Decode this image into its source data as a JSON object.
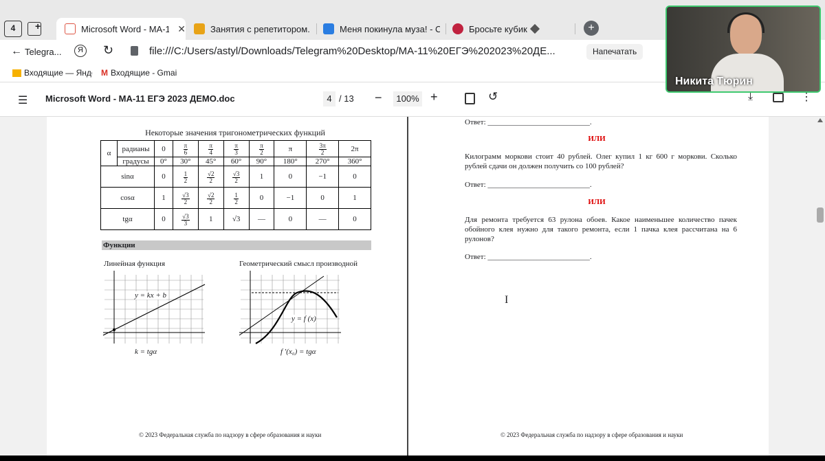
{
  "tabs": {
    "counter": "4",
    "items": [
      {
        "label": "Microsoft Word - МА-1"
      },
      {
        "label": "Занятия с репетитором. М"
      },
      {
        "label": "Меня покинула муза! - Сл"
      },
      {
        "label": "Бросьте кубик"
      }
    ]
  },
  "address": {
    "back_label": "Telegra...",
    "url": "file:///C:/Users/astyl/Downloads/Telegram%20Desktop/МА-11%20ЕГЭ%202023%20ДЕ...",
    "print_label": "Напечатать"
  },
  "bookmarks": [
    {
      "label": "Входящие — Янде"
    },
    {
      "label": "Входящие - Gmai"
    }
  ],
  "pdf": {
    "title": "Microsoft Word - МА-11 ЕГЭ 2023 ДЕМО.doc",
    "page": "4",
    "total": "/ 13",
    "zoom": "100%"
  },
  "left_page": {
    "table_title": "Некоторые значения тригонометрических функций",
    "row_alpha": "α",
    "row_rad": "радианы",
    "row_deg": "градусы",
    "rad": [
      "0",
      "π/6",
      "π/4",
      "π/3",
      "π/2",
      "π",
      "3π/2",
      "2π"
    ],
    "deg": [
      "0°",
      "30°",
      "45°",
      "60°",
      "90°",
      "180°",
      "270°",
      "360°"
    ],
    "sin_label": "sinα",
    "cos_label": "cosα",
    "tg_label": "tgα",
    "sin": [
      "0",
      "1/2",
      "√2/2",
      "√3/2",
      "1",
      "0",
      "−1",
      "0"
    ],
    "cos": [
      "1",
      "√3/2",
      "√2/2",
      "1/2",
      "0",
      "−1",
      "0",
      "1"
    ],
    "tg": [
      "0",
      "√3/3",
      "1",
      "√3",
      "—",
      "0",
      "—",
      "0"
    ],
    "section": "Функции",
    "g1_title": "Линейная функция",
    "g1_formula": "y = kx + b",
    "g1_caption": "k = tgα",
    "g2_title": "Геометрический смысл производной",
    "g2_formula": "y = f (x)",
    "g2_caption": "f ′(x₀) = tgα",
    "footer": "© 2023 Федеральная служба по надзору в сфере образования и науки"
  },
  "right_page": {
    "answer": "Ответ: ___________________________.",
    "or": "ИЛИ",
    "q1": "Килограмм моркови стоит 40 рублей. Олег купил 1 кг 600 г моркови. Сколько рублей сдачи он должен получить со 100 рублей?",
    "q2": "Для ремонта требуется 63 рулона обоев. Какое наименьшее количество пачек обойного клея нужно для такого ремонта, если 1 пачка клея рассчитана на 6 рулонов?",
    "footer": "© 2023 Федеральная служба по надзору в сфере образования и науки"
  },
  "camera": {
    "name": "Никита Тюрин"
  }
}
